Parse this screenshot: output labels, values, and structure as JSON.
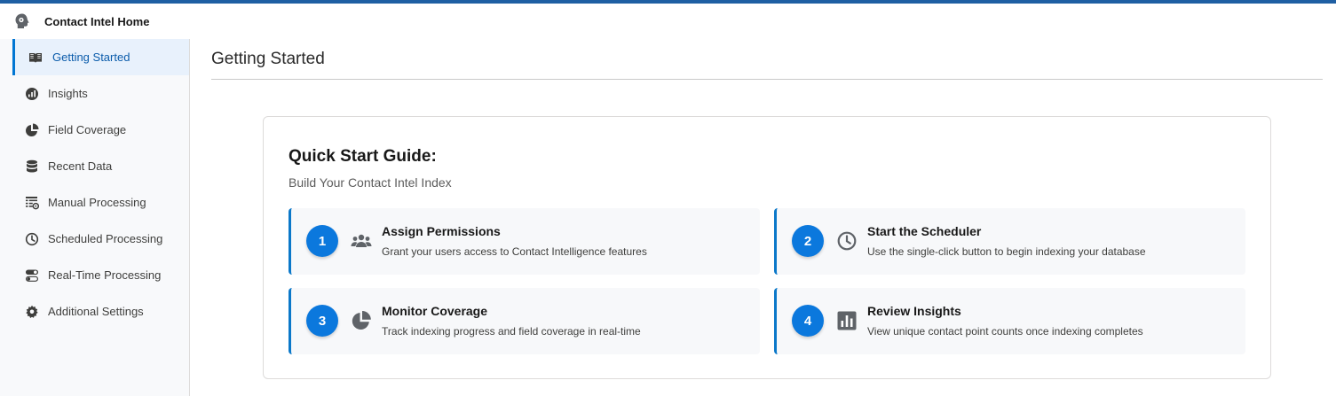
{
  "app": {
    "title": "Contact Intel Home",
    "logo_icon": "brain-gear-icon"
  },
  "colors": {
    "accent": "#0176d3",
    "step_badge": "#0b78dd",
    "active_bg": "#e8f1fc",
    "active_text": "#0b5cab"
  },
  "sidebar": {
    "items": [
      {
        "label": "Getting Started",
        "icon": "book-icon",
        "active": true
      },
      {
        "label": "Insights",
        "icon": "insights-icon",
        "active": false
      },
      {
        "label": "Field Coverage",
        "icon": "pie-chart-icon",
        "active": false
      },
      {
        "label": "Recent Data",
        "icon": "database-icon",
        "active": false
      },
      {
        "label": "Manual Processing",
        "icon": "table-settings-icon",
        "active": false
      },
      {
        "label": "Scheduled Processing",
        "icon": "clock-icon",
        "active": false
      },
      {
        "label": "Real-Time Processing",
        "icon": "toggle-icon",
        "active": false
      },
      {
        "label": "Additional Settings",
        "icon": "gear-icon",
        "active": false
      }
    ]
  },
  "main": {
    "title": "Getting Started",
    "guide": {
      "heading": "Quick Start Guide:",
      "subheading": "Build Your Contact Intel Index",
      "steps": [
        {
          "number": "1",
          "icon": "users-icon",
          "title": "Assign Permissions",
          "description": "Grant your users access to Contact Intelligence features"
        },
        {
          "number": "2",
          "icon": "clock-icon",
          "title": "Start the Scheduler",
          "description": "Use the single-click button to begin indexing your database"
        },
        {
          "number": "3",
          "icon": "pie-chart-icon",
          "title": "Monitor Coverage",
          "description": "Track indexing progress and field coverage in real-time"
        },
        {
          "number": "4",
          "icon": "bar-chart-icon",
          "title": "Review Insights",
          "description": "View unique contact point counts once indexing completes"
        }
      ]
    }
  }
}
